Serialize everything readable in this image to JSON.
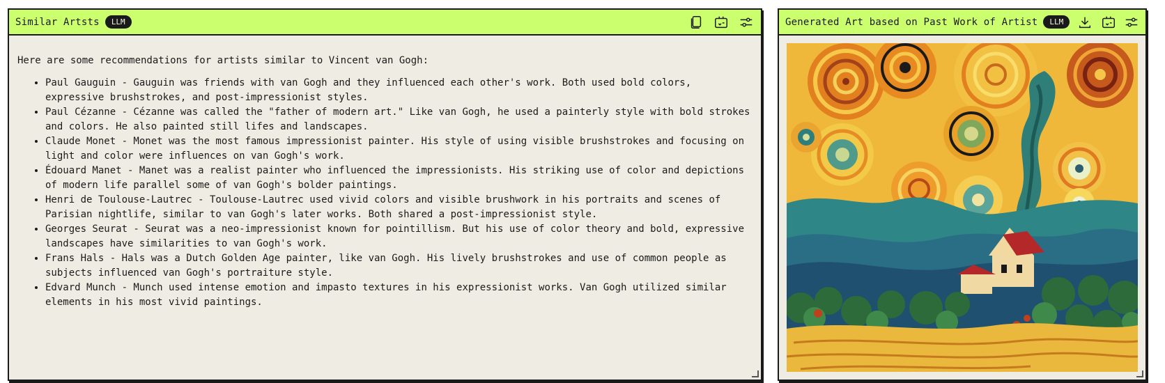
{
  "left_panel": {
    "title": "Similar Artsts",
    "badge": "LLM",
    "intro": "Here are some recommendations for artists similar to Vincent van Gogh:",
    "artists": [
      "Paul Gauguin - Gauguin was friends with van Gogh and they influenced each other's work. Both used bold colors, expressive brushstrokes, and post-impressionist styles.",
      "Paul Cézanne - Cézanne was called the \"father of modern art.\" Like van Gogh, he used a painterly style with bold strokes and colors. He also painted still lifes and landscapes.",
      "Claude Monet - Monet was the most famous impressionist painter. His style of using visible brushstrokes and focusing on light and color were influences on van Gogh's work.",
      "Édouard Manet - Manet was a realist painter who influenced the impressionists. His striking use of color and depictions of modern life parallel some of van Gogh's bolder paintings.",
      "Henri de Toulouse-Lautrec - Toulouse-Lautrec used vivid colors and visible brushwork in his portraits and scenes of Parisian nightlife, similar to van Gogh's later works. Both shared a post-impressionist style.",
      "Georges Seurat - Seurat was a neo-impressionist known for pointillism. But his use of color theory and bold, expressive landscapes have similarities to van Gogh's work.",
      "Frans Hals - Hals was a Dutch Golden Age painter, like van Gogh. His lively brushstrokes and use of common people as subjects influenced van Gogh's portraiture style.",
      "Edvard Munch - Munch used intense emotion and impasto textures in his expressionist works. Van Gogh utilized similar elements in his most vivid paintings."
    ],
    "icons": [
      "copy-icon",
      "share-icon",
      "settings-icon"
    ]
  },
  "right_panel": {
    "title": "Generated Art based on Past Work of Artist",
    "badge": "LLM",
    "icons": [
      "download-icon",
      "share-icon",
      "settings-icon"
    ]
  },
  "colors": {
    "header": "#cbff6e",
    "panel_bg": "#efede3",
    "border": "#1a1a1a"
  }
}
